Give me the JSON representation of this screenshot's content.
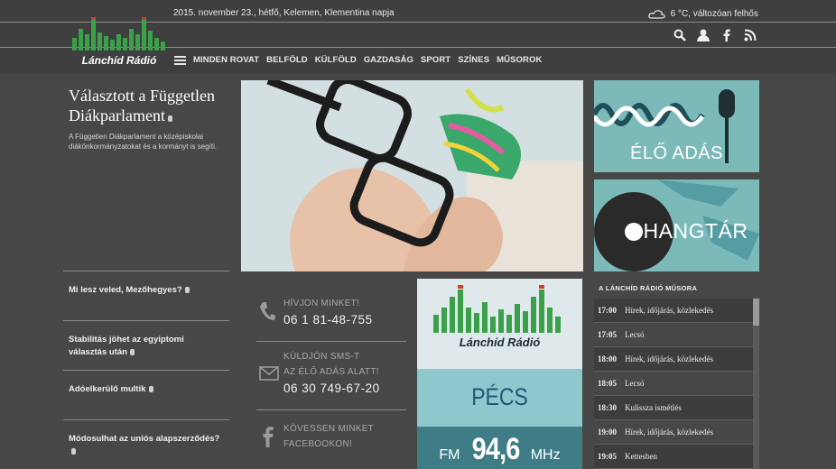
{
  "header": {
    "date_line": "2015. november 23., hétfő, Kelemen, Klementina napja",
    "weather": "6 °C, változóan felhős",
    "logo_text": "Lánchíd Rádió"
  },
  "nav": {
    "items": [
      "MINDEN ROVAT",
      "BELFÖLD",
      "KÜLFÖLD",
      "GAZDASÁG",
      "SPORT",
      "SZÍNES",
      "MŰSOROK"
    ]
  },
  "feature": {
    "title": "Választott a Független Diákparlament",
    "description": "A Független Diákparlament a középiskolai diákönkormányzatokat és a kormányt is segíti."
  },
  "tiles": {
    "live": "ÉLŐ ADÁS",
    "archive": "HANGTÁR"
  },
  "news": [
    {
      "title": "Mi lesz veled, Mezőhegyes?"
    },
    {
      "title": "Stabilitás jöhet az egyiptomi választás után"
    },
    {
      "title": "Adóelkerülő multik"
    },
    {
      "title": "Módosulhat az uniós alapszerződés?"
    }
  ],
  "contact": {
    "call_label": "HÍVJON MINKET!",
    "call_number": "06 1 81-48-755",
    "sms_label_1": "KÜLDJÖN SMS-T",
    "sms_label_2": "AZ ÉLŐ ADÁS ALATT!",
    "sms_number": "06 30 749-67-20",
    "fb_label_1": "KÖVESSEN MINKET",
    "fb_label_2": "FACEBOOKON!"
  },
  "station": {
    "logo_text": "Lánchíd Rádió",
    "city": "PÉCS",
    "fm": "FM",
    "frequency": "94,6",
    "unit": "MHz"
  },
  "schedule": {
    "title": "A LÁNCHÍD RÁDIÓ MŰSORA",
    "rows": [
      {
        "time": "17:00",
        "show": "Hírek, időjárás, közlekedés"
      },
      {
        "time": "17:05",
        "show": "Lecsó"
      },
      {
        "time": "18:00",
        "show": "Hírek, időjárás, közlekedés"
      },
      {
        "time": "18:05",
        "show": "Lecsó"
      },
      {
        "time": "18:30",
        "show": "Kulissza ismétlés"
      },
      {
        "time": "19:00",
        "show": "Hírek, időjárás, közlekedés"
      },
      {
        "time": "19:05",
        "show": "Kettesben"
      }
    ]
  },
  "colors": {
    "background": "#474747",
    "teal": "#6fb0b0",
    "logo_green": "#3aa14a",
    "logo_red": "#d93a2a"
  }
}
